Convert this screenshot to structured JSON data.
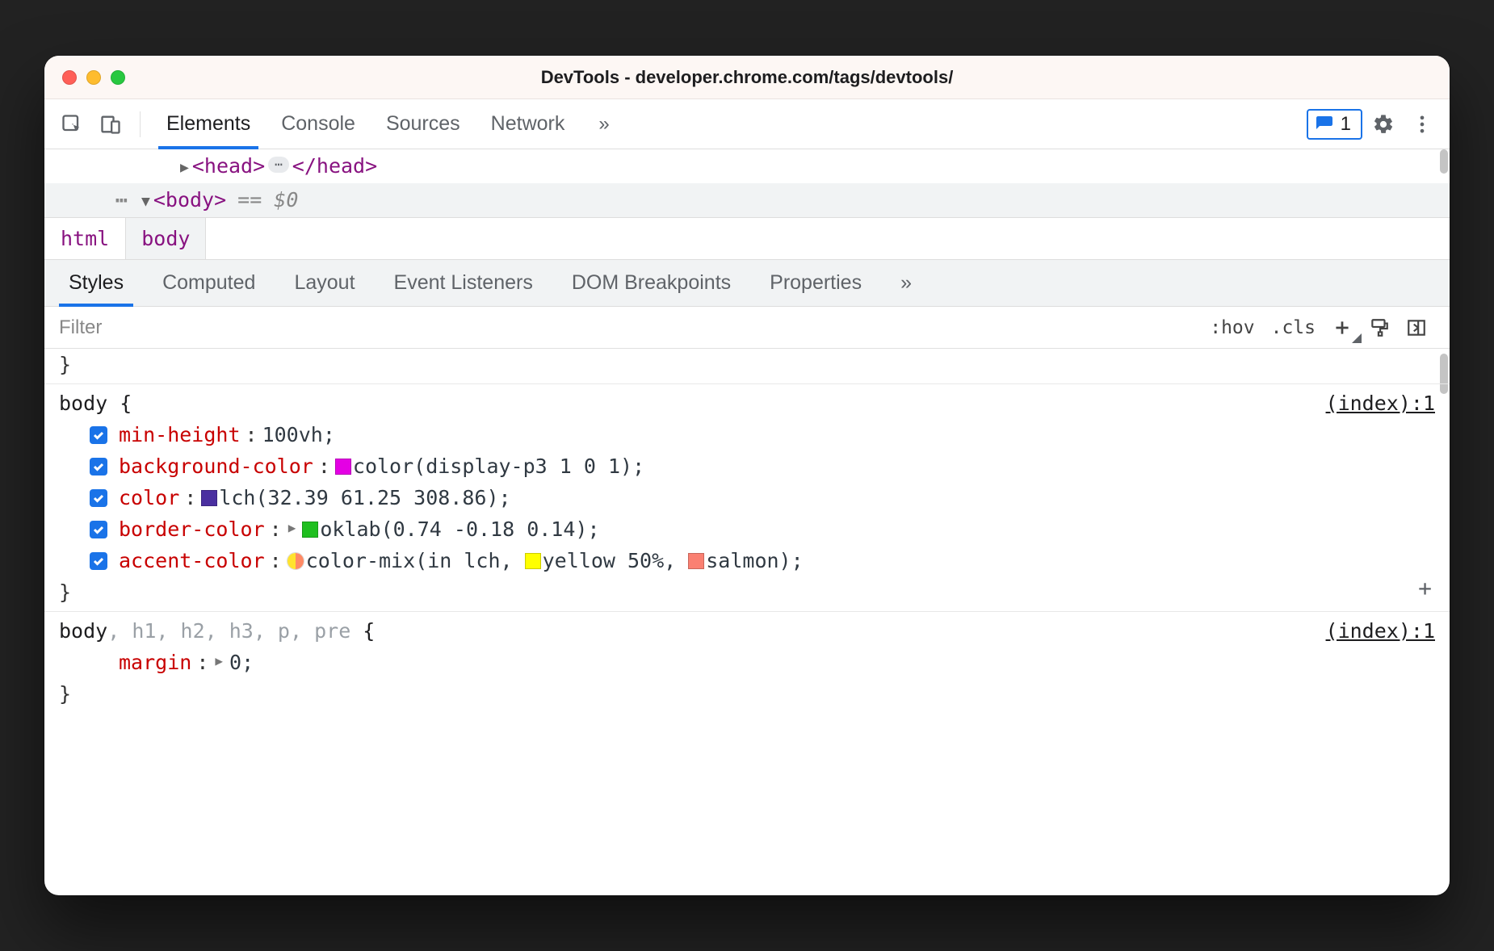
{
  "title": "DevTools - developer.chrome.com/tags/devtools/",
  "main_tabs": [
    "Elements",
    "Console",
    "Sources",
    "Network"
  ],
  "main_tabs_overflow": "»",
  "issues_count": "1",
  "dom": {
    "head_open": "<head>",
    "head_close": "</head>",
    "body_open": "<body>",
    "eq0": "== $0"
  },
  "breadcrumbs": [
    "html",
    "body"
  ],
  "sub_tabs": [
    "Styles",
    "Computed",
    "Layout",
    "Event Listeners",
    "DOM Breakpoints",
    "Properties"
  ],
  "sub_tabs_overflow": "»",
  "styles_toolbar": {
    "filter_placeholder": "Filter",
    "hov": ":hov",
    "cls": ".cls"
  },
  "rules": [
    {
      "closing_only": "}"
    },
    {
      "selector_main": "body",
      "selector_rest": "",
      "source": "(index):1",
      "decls": [
        {
          "prop": "min-height",
          "value_plain": "100vh"
        },
        {
          "prop": "background-color",
          "swatch": "#e400e4",
          "value_plain": "color(display-p3 1 0 1)"
        },
        {
          "prop": "color",
          "swatch": "#4a2fa0",
          "value_plain": "lch(32.39 61.25 308.86)"
        },
        {
          "prop": "border-color",
          "expand": true,
          "swatch": "#1fbf1f",
          "value_plain": "oklab(0.74 -0.18 0.14)"
        },
        {
          "prop": "accent-color",
          "mix": true,
          "value_pre": "color-mix(in lch, ",
          "swatch2": "#ffff00",
          "value_mid": "yellow 50%, ",
          "swatch3": "#fa8072",
          "value_post": "salmon)"
        }
      ],
      "show_add": true
    },
    {
      "selector_main": "body",
      "selector_rest": ", h1, h2, h3, p, pre",
      "source": "(index):1",
      "decls": [
        {
          "prop": "margin",
          "expand": true,
          "value_plain": "0",
          "no_check": true
        }
      ],
      "no_close": true
    }
  ]
}
